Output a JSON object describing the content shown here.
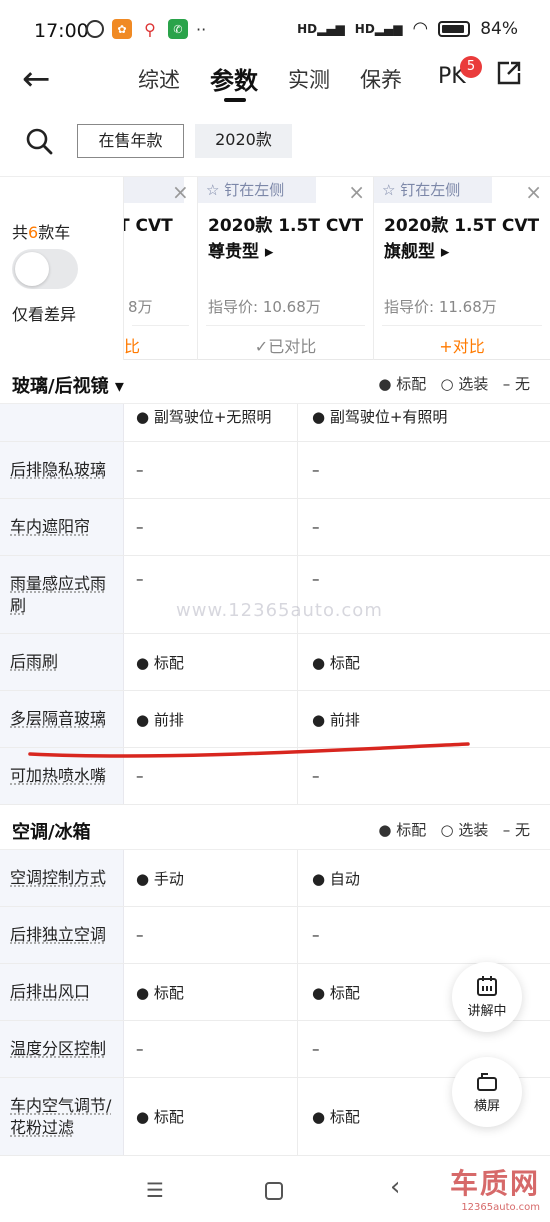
{
  "status": {
    "time": "17:00",
    "battery": "84%",
    "net1": "HD",
    "net2": "HD"
  },
  "nav": {
    "tabs": [
      {
        "label": "综述"
      },
      {
        "label": "参数"
      },
      {
        "label": "实测"
      },
      {
        "label": "保养"
      }
    ],
    "pk_label": "PK",
    "pk_count": "5"
  },
  "filters": {
    "on_sale": "在售年款",
    "year": "2020款"
  },
  "compare": {
    "total_prefix": "共",
    "total_count": "6",
    "total_suffix": "款车",
    "diff_label": "仅看差异",
    "cars": [
      {
        "name1": "T CVT",
        "price": "8万",
        "action": "比"
      },
      {
        "pin": "钉在左侧",
        "name1": "2020款 1.5T CVT",
        "name2": "尊贵型 ▸",
        "price": "指导价: 10.68万",
        "action": "✓已对比"
      },
      {
        "pin": "钉在左侧",
        "name1": "2020款 1.5T CVT",
        "name2": "旗舰型 ▸",
        "price": "指导价: 11.68万",
        "action": "+对比"
      }
    ]
  },
  "legend": {
    "std": "● 标配",
    "opt": "○ 选装",
    "none": "– 无"
  },
  "sections": [
    {
      "title": "玻璃/后视镜 ▾",
      "rows": [
        {
          "label": "",
          "c1": "● 副驾驶位+无照明",
          "c2": "● 副驾驶位+有照明"
        },
        {
          "label": "后排隐私玻璃",
          "c1": "–",
          "c2": "–"
        },
        {
          "label": "车内遮阳帘",
          "c1": "–",
          "c2": "–"
        },
        {
          "label": "雨量感应式雨刷",
          "c1": "–",
          "c2": "–"
        },
        {
          "label": "后雨刷",
          "c1": "● 标配",
          "c2": "● 标配"
        },
        {
          "label": "多层隔音玻璃",
          "c1": "● 前排",
          "c2": "● 前排"
        },
        {
          "label": "可加热喷水嘴",
          "c1": "–",
          "c2": "–"
        }
      ]
    },
    {
      "title": "空调/冰箱",
      "rows": [
        {
          "label": "空调控制方式",
          "c1": "● 手动",
          "c2": "● 自动"
        },
        {
          "label": "后排独立空调",
          "c1": "–",
          "c2": "–"
        },
        {
          "label": "后排出风口",
          "c1": "● 标配",
          "c2": "● 标配"
        },
        {
          "label": "温度分区控制",
          "c1": "–",
          "c2": "–"
        },
        {
          "label": "车内空气调节/花粉过滤",
          "c1": "● 标配",
          "c2": "● 标配"
        }
      ]
    }
  ],
  "watermark": "www.12365auto.com",
  "fabs": {
    "explain": "讲解中",
    "landscape": "横屏"
  },
  "brand": {
    "name": "车质网",
    "url": "12365auto.com"
  },
  "colors": {
    "accent": "#ff7a00",
    "badge": "#ea3b3b",
    "pin": "#7c87a8"
  }
}
